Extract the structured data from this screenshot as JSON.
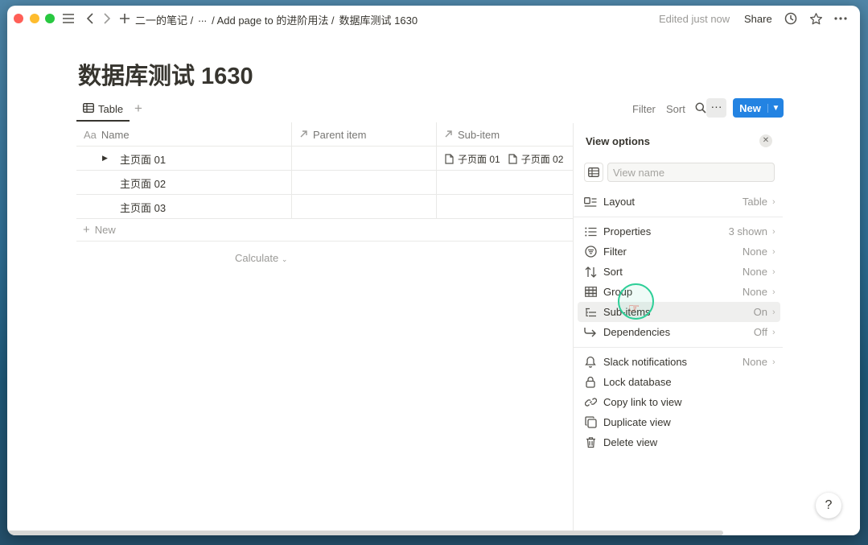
{
  "titlebar": {
    "breadcrumbs": [
      "二一的笔记 /",
      "...",
      "/ Add page to 的进阶用法 /",
      "数据库测试 1630"
    ],
    "edited": "Edited just now",
    "share": "Share"
  },
  "page": {
    "title": "数据库测试 1630"
  },
  "viewbar": {
    "tab_label": "Table",
    "filter": "Filter",
    "sort": "Sort",
    "new_label": "New"
  },
  "table": {
    "columns": [
      {
        "prefix": "Aa",
        "label": "Name"
      },
      {
        "label": "Parent item"
      },
      {
        "label": "Sub-item"
      }
    ],
    "rows": [
      {
        "name": "主页面 01",
        "parent": "",
        "sub_items": [
          "子页面 01",
          "子页面 02"
        ]
      },
      {
        "name": "主页面 02",
        "parent": "",
        "sub_items": []
      },
      {
        "name": "主页面 03",
        "parent": "",
        "sub_items": []
      }
    ],
    "add_row": "New",
    "calculate": "Calculate"
  },
  "panel": {
    "title": "View options",
    "view_name_placeholder": "View name",
    "layout": {
      "label": "Layout",
      "value": "Table"
    },
    "settings": [
      {
        "label": "Properties",
        "value": "3 shown",
        "icon": "list-icon"
      },
      {
        "label": "Filter",
        "value": "None",
        "icon": "filter-icon"
      },
      {
        "label": "Sort",
        "value": "None",
        "icon": "sort-icon"
      },
      {
        "label": "Group",
        "value": "None",
        "icon": "group-icon"
      },
      {
        "label": "Sub-items",
        "value": "On",
        "icon": "sub-items-icon"
      },
      {
        "label": "Dependencies",
        "value": "Off",
        "icon": "dependencies-icon"
      }
    ],
    "actions": [
      {
        "label": "Slack notifications",
        "value": "None"
      },
      {
        "label": "Lock database"
      },
      {
        "label": "Copy link to view"
      },
      {
        "label": "Duplicate view"
      },
      {
        "label": "Delete view"
      }
    ]
  },
  "help": "?"
}
